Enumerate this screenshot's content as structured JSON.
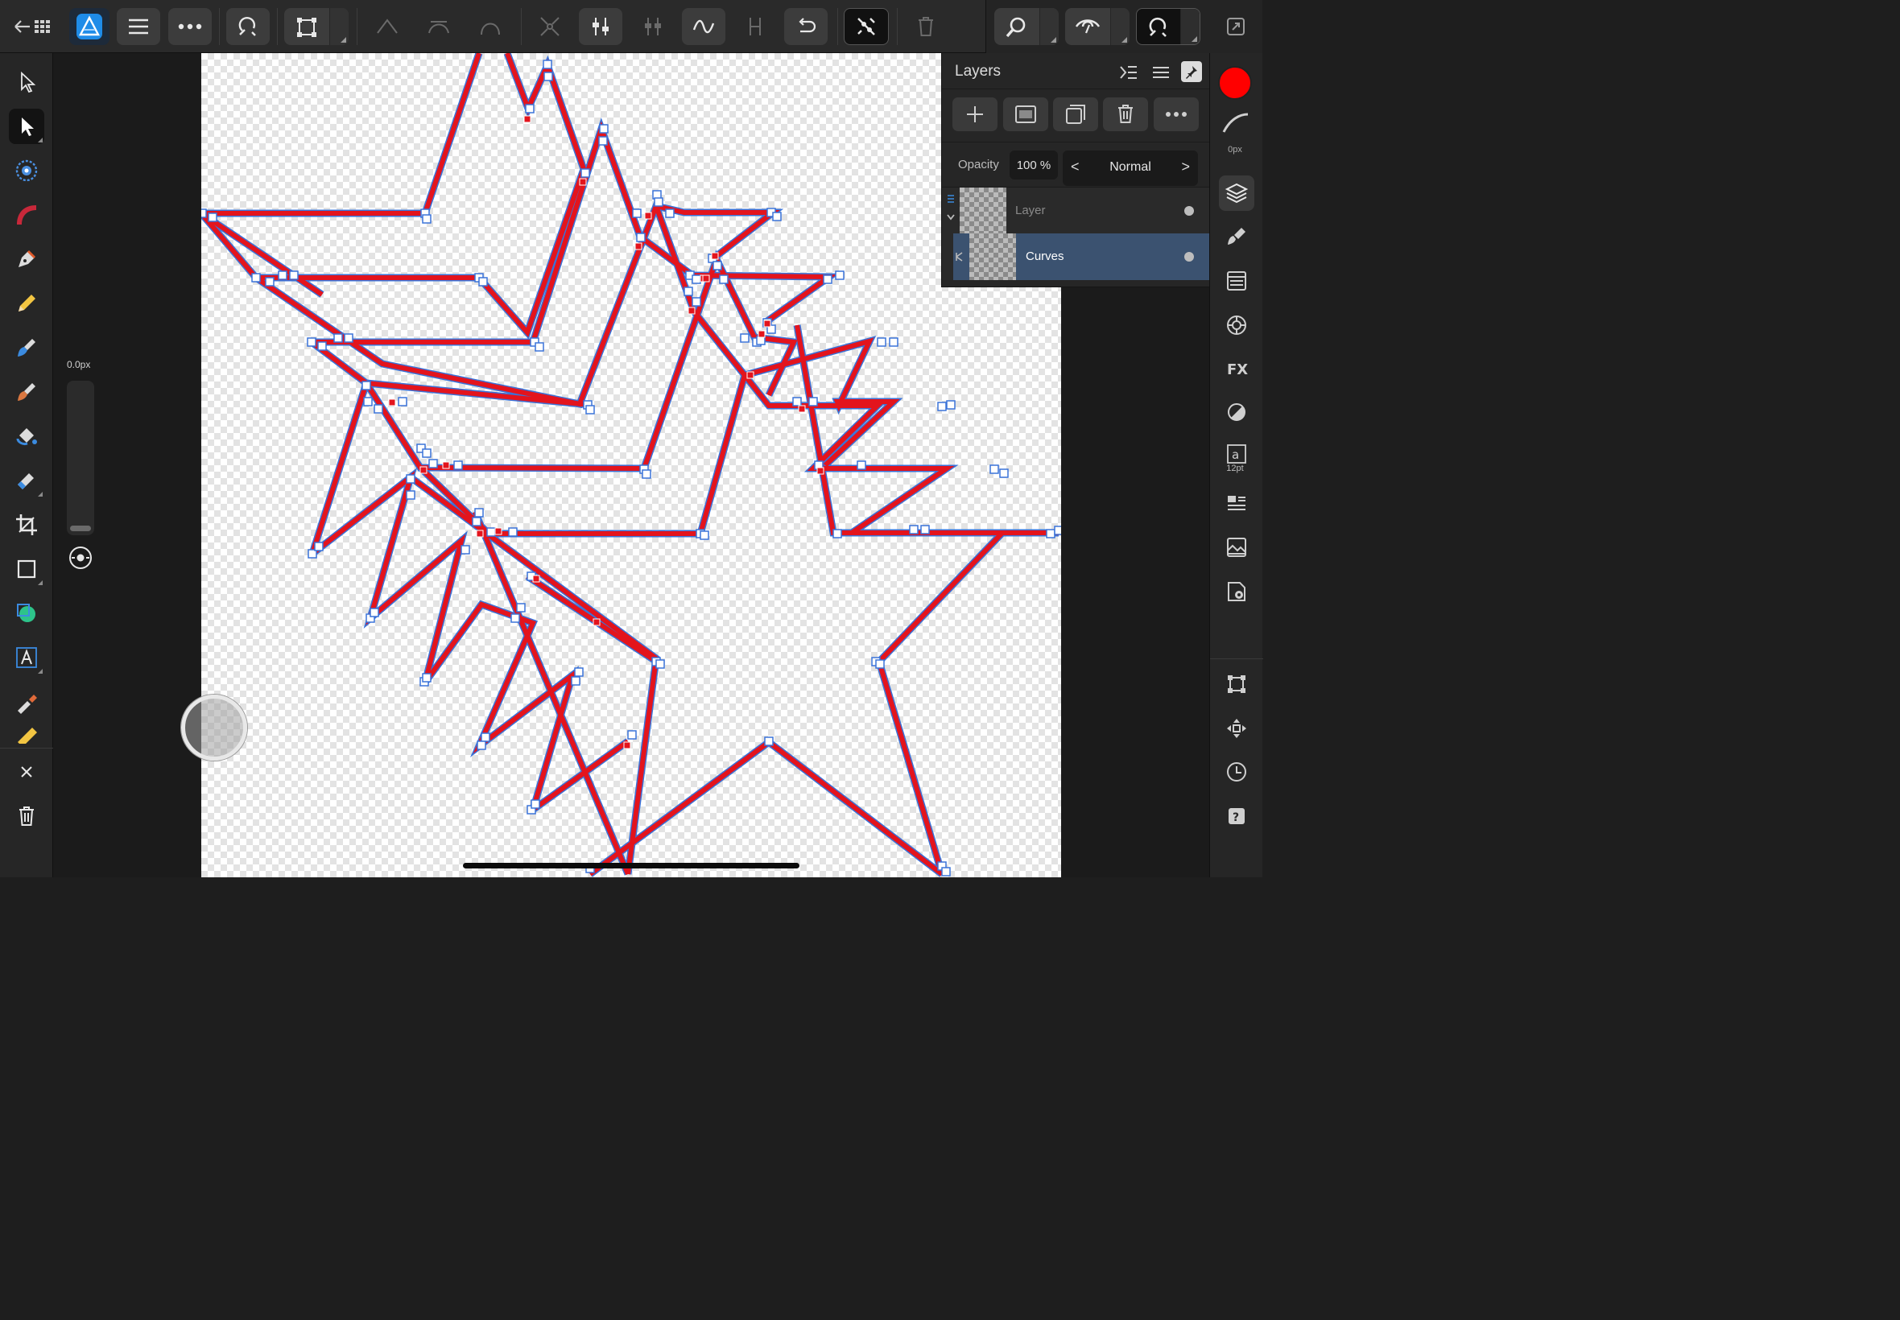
{
  "colors": {
    "accent": "#2c8be6",
    "fill_color": "#ff0000",
    "curve_stroke": "#e3141d",
    "selection_blue": "#3a73d9",
    "selected_layer": "#3b5270"
  },
  "context": {
    "width_value": "0.0px"
  },
  "layers_panel": {
    "title": "Layers",
    "opacity_label": "Opacity",
    "opacity_value": "100 %",
    "blend_mode": "Normal",
    "layers": [
      {
        "name": "Layer",
        "visible": true,
        "selected": false
      },
      {
        "name": "Curves",
        "visible": true,
        "selected": true
      }
    ]
  },
  "studio": {
    "stroke_width": "0px",
    "text_size": "12pt"
  },
  "icons": {
    "top": [
      "back-grid-icon",
      "app-logo-icon",
      "menu-icon",
      "more-icon",
      "snapping-icon",
      "transform-mode-icon",
      "sharp-node-icon",
      "smooth-node-icon",
      "smart-node-icon",
      "break-curve-icon",
      "align-nodes-icon",
      "distribute-nodes-icon",
      "curve-fit-icon",
      "join-nodes-icon",
      "reverse-curve-icon",
      "close-curve-icon",
      "delete-node-icon",
      "zoom-icon",
      "view-mode-icon",
      "snapping-toggle-icon",
      "fullscreen-icon"
    ],
    "left": [
      "move-tool-icon",
      "node-tool-icon",
      "transparency-tool-icon",
      "gradient-tool-icon",
      "pen-tool-icon",
      "pencil-tool-icon",
      "vector-brush-icon",
      "paint-brush-icon",
      "fill-tool-icon",
      "pixel-tool-icon",
      "crop-tool-icon",
      "rectangle-tool-icon",
      "shape-tool-icon",
      "text-tool-icon",
      "color-picker-icon",
      "ruler-tool-icon",
      "close-icon",
      "trash-icon"
    ],
    "studio": [
      "layers-studio-icon",
      "brushes-studio-icon",
      "stock-studio-icon",
      "effects-studio-icon",
      "fx-studio-icon",
      "adjust-studio-icon",
      "text-style-studio-icon",
      "paragraph-studio-icon",
      "assets-studio-icon",
      "settings-studio-icon",
      "transform-studio-icon",
      "navigator-studio-icon",
      "history-studio-icon",
      "help-icon"
    ]
  }
}
